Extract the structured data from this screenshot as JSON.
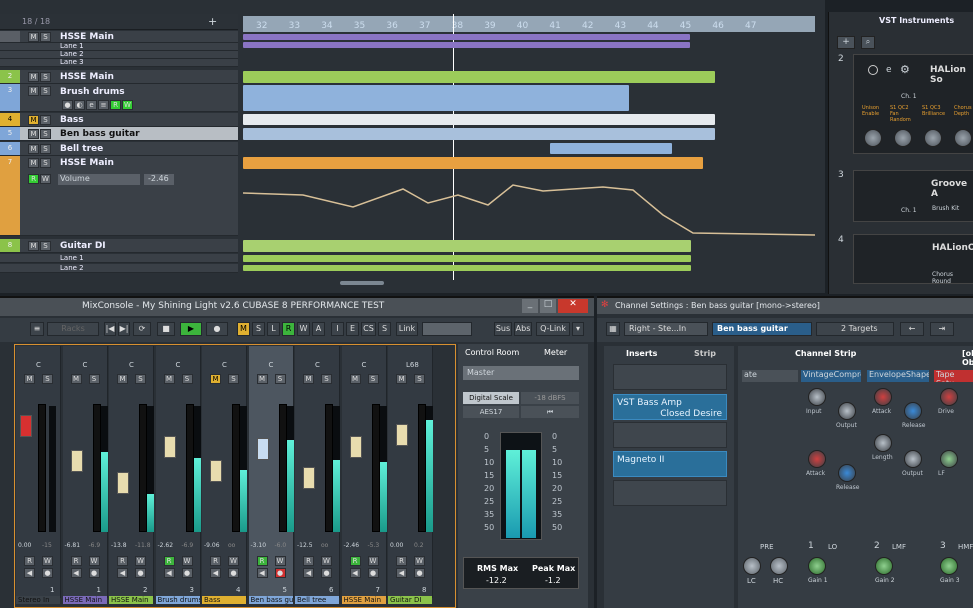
{
  "project": {
    "track_count": "18 / 18"
  },
  "ruler": [
    "32",
    "33",
    "34",
    "35",
    "36",
    "37",
    "38",
    "39",
    "40",
    "41",
    "42",
    "43",
    "44",
    "45",
    "46",
    "47"
  ],
  "tracks": [
    {
      "name": "HSSE Main",
      "color": "#7a6ab8"
    },
    {
      "name": "Lane 1",
      "color": "#7a6ab8"
    },
    {
      "name": "Lane 2",
      "color": "#7a6ab8"
    },
    {
      "name": "Lane 3",
      "color": "#7a6ab8"
    },
    {
      "name": "HSSE Main",
      "color": "#8bc34a"
    },
    {
      "name": "Brush drums",
      "color": "#7fa6d8"
    },
    {
      "name": "Bass",
      "color": "#e0b030"
    },
    {
      "name": "Ben bass guitar",
      "color": "#7fa6d8"
    },
    {
      "name": "Bell tree",
      "color": "#7fa6d8"
    },
    {
      "name": "HSSE Main",
      "color": "#e0a040"
    },
    {
      "name": "Guitar DI",
      "color": "#8bc34a"
    },
    {
      "name": "Lane 1",
      "color": "#8bc34a"
    },
    {
      "name": "Lane 2",
      "color": "#8bc34a"
    }
  ],
  "automation": {
    "param": "Volume",
    "value": "-2.46"
  },
  "vst": {
    "title": "VST Instruments",
    "slots": [
      {
        "num": "2",
        "name": "HALion So",
        "ch": "Ch. 1",
        "params": [
          "Unison Enable",
          "S1 QC2 Fan Random",
          "S1 QC3 Brilliance",
          "Chorus Depth"
        ]
      },
      {
        "num": "3",
        "name": "Groove A",
        "ch": "Ch. 1",
        "preset": "Brush Kit"
      },
      {
        "num": "4",
        "name": "HALionO",
        "preset": "Chorus Round"
      }
    ]
  },
  "mixconsole": {
    "title": "MixConsole - My Shining Light v2.6 CUBASE 8 PERFORMANCE TEST",
    "racks": "Racks",
    "link": "Link",
    "sus": "Sus",
    "abs": "Abs",
    "qlink": "Q-Link",
    "toolbar_letters": [
      "M",
      "S",
      "L",
      "R",
      "W",
      "A",
      "I",
      "E",
      "CS",
      "S"
    ],
    "channels": [
      {
        "num": "1",
        "name": "Stereo In",
        "val": "0.00",
        "peak": "-15",
        "pan": "C"
      },
      {
        "num": "1",
        "name": "HSSE Main",
        "val": "-6.81",
        "peak": "-6.9",
        "pan": "C"
      },
      {
        "num": "2",
        "name": "HSSE Main",
        "val": "-13.8",
        "peak": "-11.8",
        "pan": "C"
      },
      {
        "num": "3",
        "name": "Brush drums",
        "val": "-2.62",
        "peak": "-6.9",
        "pan": "C"
      },
      {
        "num": "4",
        "name": "Bass",
        "val": "-9.06",
        "peak": "oo",
        "pan": "C"
      },
      {
        "num": "5",
        "name": "Ben bass guitar",
        "val": "-3.10",
        "peak": "-6.0",
        "pan": "C"
      },
      {
        "num": "6",
        "name": "Bell tree",
        "val": "-12.5",
        "peak": "oo",
        "pan": "C"
      },
      {
        "num": "7",
        "name": "HSSE Main",
        "val": "-2.46",
        "peak": "-5.3",
        "pan": "C"
      },
      {
        "num": "8",
        "name": "Guitar DI",
        "val": "0.00",
        "peak": "0.2",
        "pan": "L68"
      }
    ],
    "control_room": "Control Room",
    "meter": "Meter",
    "master": "Master",
    "digital_scale": "Digital Scale",
    "dbfs": "-18 dBFS",
    "aes17": "AES17",
    "scale": [
      "0",
      "5",
      "10",
      "15",
      "20",
      "25",
      "35",
      "50"
    ],
    "rms_max": "RMS Max",
    "rms_val": "-12.2",
    "peak_max": "Peak Max",
    "peak_val": "-1.2"
  },
  "channel_settings": {
    "title": "Channel Settings : Ben bass guitar [mono->stereo]",
    "route": "Right - Ste...In",
    "track": "Ben bass guitar",
    "targets": "2 Targets",
    "inserts": "Inserts",
    "strip": "Strip",
    "channel_strip": "Channel Strip",
    "eq": {
      "pre": "PRE",
      "bands": [
        "1",
        "LO",
        "2",
        "LMF",
        "3",
        "HMF"
      ],
      "lc": "LC",
      "hc": "HC",
      "gain": "Gain 1",
      "gain2": "Gain 2",
      "gain3": "Gain 3"
    },
    "insert_slots": [
      {
        "name": "VST Bass Amp",
        "preset": "Closed Desire"
      },
      {
        "name": "Magneto II",
        "preset": ""
      }
    ],
    "modules": [
      "ate",
      "VintageCompre",
      "EnvelopeShape",
      "Tape Satu"
    ],
    "knob_labels": [
      "Input",
      "Output",
      "Attack",
      "Release",
      "Length",
      "Output",
      "Drive",
      "Attack",
      "Release",
      "LF"
    ]
  }
}
